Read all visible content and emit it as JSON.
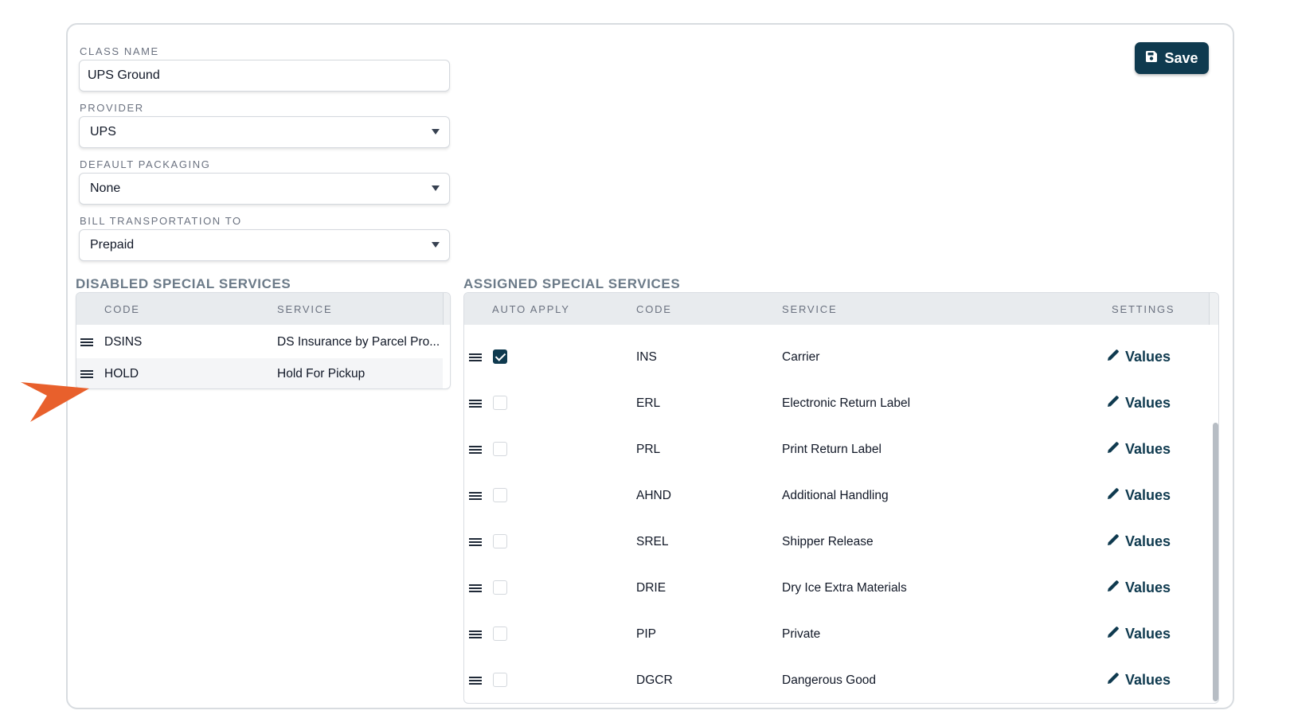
{
  "form": {
    "class_name": {
      "label": "CLASS NAME",
      "value": "UPS Ground"
    },
    "provider": {
      "label": "PROVIDER",
      "value": "UPS"
    },
    "default_packaging": {
      "label": "DEFAULT PACKAGING",
      "value": "None"
    },
    "bill_transportation": {
      "label": "BILL TRANSPORTATION TO",
      "value": "Prepaid"
    }
  },
  "toolbar": {
    "save_label": "Save",
    "save_icon": "floppy-disk-icon"
  },
  "disabled": {
    "title": "DISABLED SPECIAL SERVICES",
    "columns": [
      "CODE",
      "SERVICE"
    ],
    "rows": [
      {
        "code": "DSINS",
        "service": "DS Insurance by Parcel Pro..."
      },
      {
        "code": "HOLD",
        "service": "Hold For Pickup"
      }
    ]
  },
  "assigned": {
    "title": "ASSIGNED SPECIAL SERVICES",
    "columns": [
      "AUTO APPLY",
      "CODE",
      "SERVICE",
      "SETTINGS"
    ],
    "settings_label": "Values",
    "rows": [
      {
        "code": "INS",
        "service": "Carrier",
        "auto_apply": true
      },
      {
        "code": "ERL",
        "service": "Electronic Return Label",
        "auto_apply": false
      },
      {
        "code": "PRL",
        "service": "Print Return Label",
        "auto_apply": false
      },
      {
        "code": "AHND",
        "service": "Additional Handling",
        "auto_apply": false
      },
      {
        "code": "SREL",
        "service": "Shipper Release",
        "auto_apply": false
      },
      {
        "code": "DRIE",
        "service": "Dry Ice Extra Materials",
        "auto_apply": false
      },
      {
        "code": "PIP",
        "service": "Private",
        "auto_apply": false
      },
      {
        "code": "DGCR",
        "service": "Dangerous Good",
        "auto_apply": false
      }
    ]
  },
  "colors": {
    "brand": "#0f3a4f",
    "annotation_arrow": "#e8602c",
    "header_bg": "#e8ebee"
  }
}
